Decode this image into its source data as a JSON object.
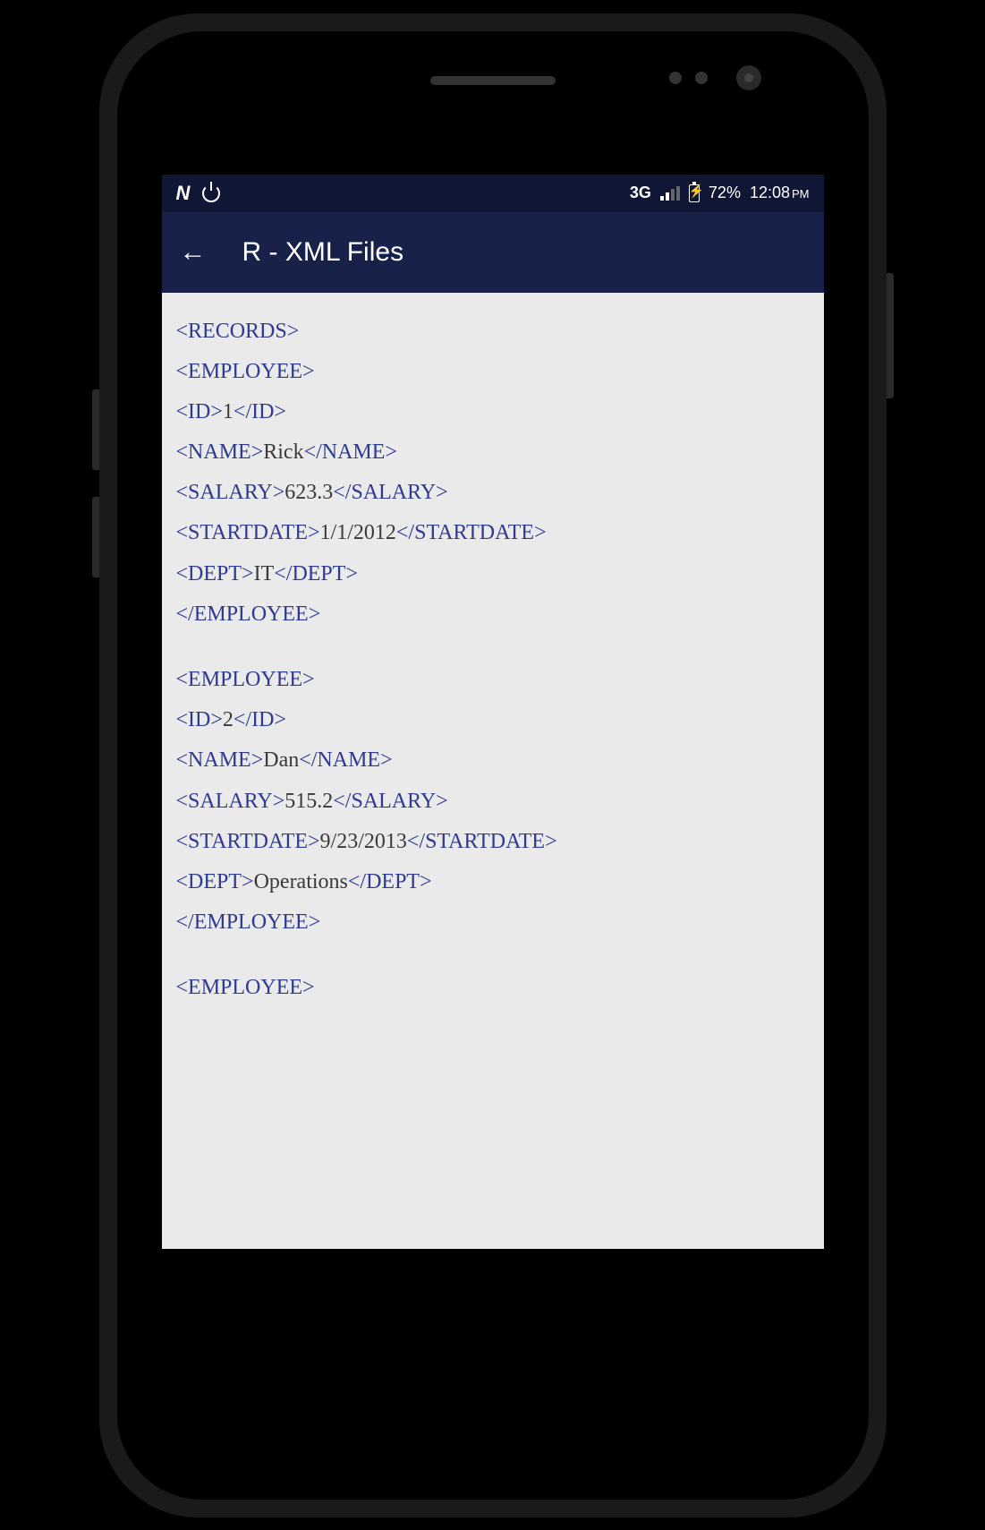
{
  "status_bar": {
    "n_icon": "N",
    "network_label": "3G",
    "battery_pct": "72%",
    "time": "12:08",
    "time_suffix": "PM"
  },
  "app_bar": {
    "title": "R - XML Files"
  },
  "xml": {
    "records_open": "<RECORDS>",
    "employee_open": "<EMPLOYEE>",
    "employee_close": "</EMPLOYEE>",
    "id_open": "<ID>",
    "id_close": "</ID>",
    "name_open": "<NAME>",
    "name_close": "</NAME>",
    "salary_open": "<SALARY>",
    "salary_close": "</SALARY>",
    "startdate_open": "<STARTDATE>",
    "startdate_close": "</STARTDATE>",
    "dept_open": "<DEPT>",
    "dept_close": "</DEPT>",
    "employees": [
      {
        "id": "1",
        "name": "Rick",
        "salary": "623.3",
        "startdate": "1/1/2012",
        "dept": "IT"
      },
      {
        "id": "2",
        "name": "Dan",
        "salary": "515.2",
        "startdate": "9/23/2013",
        "dept": "Operations"
      }
    ]
  }
}
